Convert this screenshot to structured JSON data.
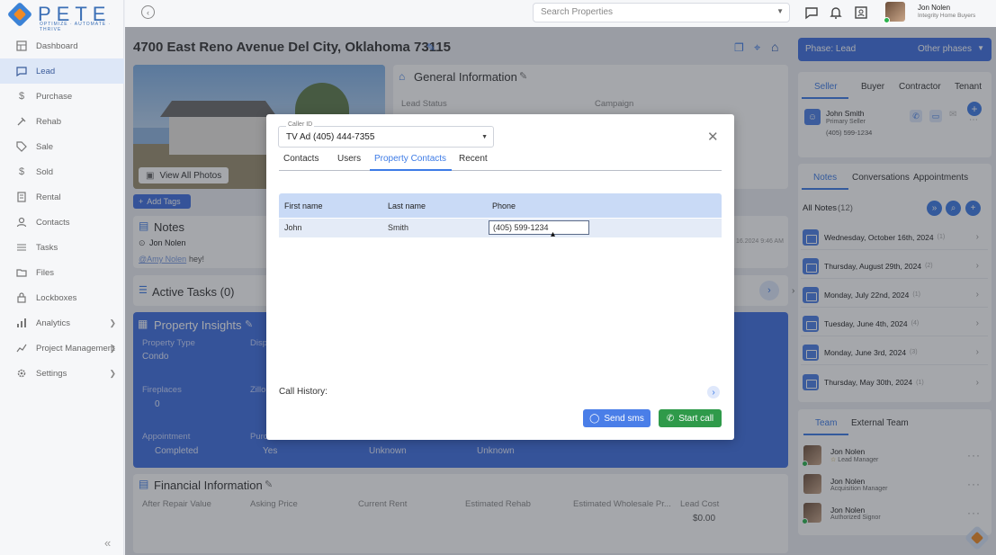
{
  "brand": {
    "name": "PETE",
    "tagline": "OPTIMIZE · AUTOMATE · THRIVE"
  },
  "sidebar": {
    "items": [
      {
        "label": "Dashboard"
      },
      {
        "label": "Lead"
      },
      {
        "label": "Purchase"
      },
      {
        "label": "Rehab"
      },
      {
        "label": "Sale"
      },
      {
        "label": "Sold"
      },
      {
        "label": "Rental"
      },
      {
        "label": "Contacts"
      },
      {
        "label": "Tasks"
      },
      {
        "label": "Files"
      },
      {
        "label": "Lockboxes"
      },
      {
        "label": "Analytics"
      },
      {
        "label": "Project Management"
      },
      {
        "label": "Settings"
      }
    ],
    "collapse_glyph": "«"
  },
  "topbar": {
    "search_placeholder": "Search Properties",
    "user_name": "Jon Nolen",
    "user_company": "Integrity Home Buyers"
  },
  "page": {
    "address": "4700 East Reno Avenue Del City, Oklahoma 73115",
    "view_photos": "View All Photos",
    "add_tags": "Add Tags"
  },
  "phase": {
    "current": "Phase: Lead",
    "other": "Other phases"
  },
  "general": {
    "title": "General Information",
    "lead_status_label": "Lead Status",
    "campaign_label": "Campaign"
  },
  "notes": {
    "title": "Notes",
    "author": "Jon Nolen",
    "mention": "@Amy Nolen",
    "text": "hey!",
    "timestamp": "16.2024 9:46 AM"
  },
  "tasks": {
    "title": "Active Tasks (0)"
  },
  "insights": {
    "title": "Property Insights",
    "property_type_label": "Property Type",
    "property_type": "Condo",
    "disp_label": "Disp",
    "fireplaces_label": "Fireplaces",
    "fireplaces": "0",
    "zillow_label": "Zillo",
    "appointment_label": "Appointment",
    "appointment": "Completed",
    "purch_label": "Purc",
    "yes": "Yes",
    "unknown1": "Unknown",
    "unknown2": "Unknown"
  },
  "financial": {
    "title": "Financial Information",
    "cols": [
      "After Repair Value",
      "Asking Price",
      "Current Rent",
      "Estimated Rehab",
      "Estimated Wholesale Pr...",
      "Lead Cost"
    ],
    "lead_cost": "$0.00"
  },
  "contacts_card": {
    "tabs": [
      "Seller",
      "Buyer",
      "Contractor",
      "Tenant"
    ],
    "name": "John Smith",
    "role": "Primary Seller",
    "phone": "(405) 599-1234"
  },
  "notes_panel": {
    "tabs": [
      "Notes",
      "Conversations",
      "Appointments"
    ],
    "all_notes": "All Notes",
    "count": "(12)",
    "entries": [
      {
        "date": "Wednesday, October 16th, 2024",
        "n": "(1)"
      },
      {
        "date": "Thursday, August 29th, 2024",
        "n": "(2)"
      },
      {
        "date": "Monday, July 22nd, 2024",
        "n": "(1)"
      },
      {
        "date": "Tuesday, June 4th, 2024",
        "n": "(4)"
      },
      {
        "date": "Monday, June 3rd, 2024",
        "n": "(3)"
      },
      {
        "date": "Thursday, May 30th, 2024",
        "n": "(1)"
      }
    ]
  },
  "team_panel": {
    "tabs": [
      "Team",
      "External Team"
    ],
    "members": [
      {
        "name": "Jon Nolen",
        "role": "Lead Manager"
      },
      {
        "name": "Jon Nolen",
        "role": "Acquisition Manager"
      },
      {
        "name": "Jon Nolen",
        "role": "Authorized Signor"
      }
    ]
  },
  "modal": {
    "caller_id_label": "Caller ID",
    "caller_id_value": "TV Ad (405) 444-7355",
    "tabs": [
      "Contacts",
      "Users",
      "Property Contacts",
      "Recent"
    ],
    "table": {
      "headers": [
        "First name",
        "Last name",
        "Phone"
      ],
      "rows": [
        {
          "first": "John",
          "last": "Smith",
          "phone": "(405) 599-1234"
        }
      ]
    },
    "call_history_label": "Call History:",
    "send_sms": "Send sms",
    "start_call": "Start call"
  },
  "colors": {
    "accent": "#3f6fe0",
    "green": "#2f9a4a",
    "sidebar_active": "#dde7f7"
  }
}
